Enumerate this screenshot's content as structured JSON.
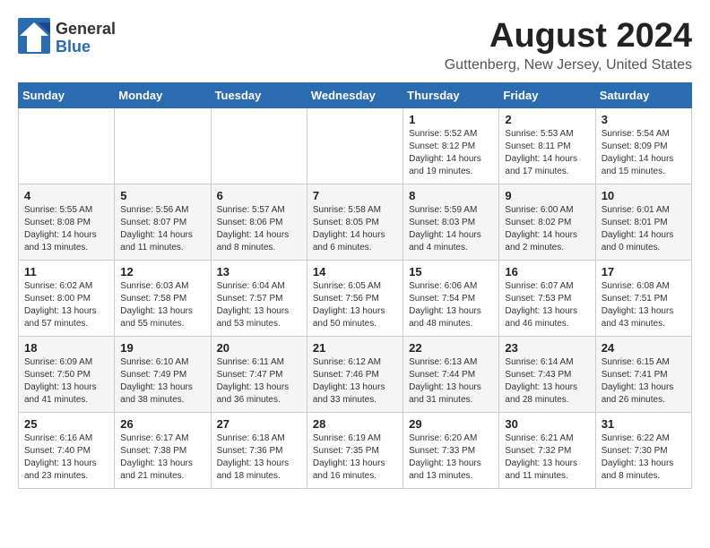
{
  "logo": {
    "general": "General",
    "blue": "Blue"
  },
  "title": {
    "month_year": "August 2024",
    "location": "Guttenberg, New Jersey, United States"
  },
  "headers": [
    "Sunday",
    "Monday",
    "Tuesday",
    "Wednesday",
    "Thursday",
    "Friday",
    "Saturday"
  ],
  "weeks": [
    [
      {
        "day": "",
        "info": ""
      },
      {
        "day": "",
        "info": ""
      },
      {
        "day": "",
        "info": ""
      },
      {
        "day": "",
        "info": ""
      },
      {
        "day": "1",
        "info": "Sunrise: 5:52 AM\nSunset: 8:12 PM\nDaylight: 14 hours\nand 19 minutes."
      },
      {
        "day": "2",
        "info": "Sunrise: 5:53 AM\nSunset: 8:11 PM\nDaylight: 14 hours\nand 17 minutes."
      },
      {
        "day": "3",
        "info": "Sunrise: 5:54 AM\nSunset: 8:09 PM\nDaylight: 14 hours\nand 15 minutes."
      }
    ],
    [
      {
        "day": "4",
        "info": "Sunrise: 5:55 AM\nSunset: 8:08 PM\nDaylight: 14 hours\nand 13 minutes."
      },
      {
        "day": "5",
        "info": "Sunrise: 5:56 AM\nSunset: 8:07 PM\nDaylight: 14 hours\nand 11 minutes."
      },
      {
        "day": "6",
        "info": "Sunrise: 5:57 AM\nSunset: 8:06 PM\nDaylight: 14 hours\nand 8 minutes."
      },
      {
        "day": "7",
        "info": "Sunrise: 5:58 AM\nSunset: 8:05 PM\nDaylight: 14 hours\nand 6 minutes."
      },
      {
        "day": "8",
        "info": "Sunrise: 5:59 AM\nSunset: 8:03 PM\nDaylight: 14 hours\nand 4 minutes."
      },
      {
        "day": "9",
        "info": "Sunrise: 6:00 AM\nSunset: 8:02 PM\nDaylight: 14 hours\nand 2 minutes."
      },
      {
        "day": "10",
        "info": "Sunrise: 6:01 AM\nSunset: 8:01 PM\nDaylight: 14 hours\nand 0 minutes."
      }
    ],
    [
      {
        "day": "11",
        "info": "Sunrise: 6:02 AM\nSunset: 8:00 PM\nDaylight: 13 hours\nand 57 minutes."
      },
      {
        "day": "12",
        "info": "Sunrise: 6:03 AM\nSunset: 7:58 PM\nDaylight: 13 hours\nand 55 minutes."
      },
      {
        "day": "13",
        "info": "Sunrise: 6:04 AM\nSunset: 7:57 PM\nDaylight: 13 hours\nand 53 minutes."
      },
      {
        "day": "14",
        "info": "Sunrise: 6:05 AM\nSunset: 7:56 PM\nDaylight: 13 hours\nand 50 minutes."
      },
      {
        "day": "15",
        "info": "Sunrise: 6:06 AM\nSunset: 7:54 PM\nDaylight: 13 hours\nand 48 minutes."
      },
      {
        "day": "16",
        "info": "Sunrise: 6:07 AM\nSunset: 7:53 PM\nDaylight: 13 hours\nand 46 minutes."
      },
      {
        "day": "17",
        "info": "Sunrise: 6:08 AM\nSunset: 7:51 PM\nDaylight: 13 hours\nand 43 minutes."
      }
    ],
    [
      {
        "day": "18",
        "info": "Sunrise: 6:09 AM\nSunset: 7:50 PM\nDaylight: 13 hours\nand 41 minutes."
      },
      {
        "day": "19",
        "info": "Sunrise: 6:10 AM\nSunset: 7:49 PM\nDaylight: 13 hours\nand 38 minutes."
      },
      {
        "day": "20",
        "info": "Sunrise: 6:11 AM\nSunset: 7:47 PM\nDaylight: 13 hours\nand 36 minutes."
      },
      {
        "day": "21",
        "info": "Sunrise: 6:12 AM\nSunset: 7:46 PM\nDaylight: 13 hours\nand 33 minutes."
      },
      {
        "day": "22",
        "info": "Sunrise: 6:13 AM\nSunset: 7:44 PM\nDaylight: 13 hours\nand 31 minutes."
      },
      {
        "day": "23",
        "info": "Sunrise: 6:14 AM\nSunset: 7:43 PM\nDaylight: 13 hours\nand 28 minutes."
      },
      {
        "day": "24",
        "info": "Sunrise: 6:15 AM\nSunset: 7:41 PM\nDaylight: 13 hours\nand 26 minutes."
      }
    ],
    [
      {
        "day": "25",
        "info": "Sunrise: 6:16 AM\nSunset: 7:40 PM\nDaylight: 13 hours\nand 23 minutes."
      },
      {
        "day": "26",
        "info": "Sunrise: 6:17 AM\nSunset: 7:38 PM\nDaylight: 13 hours\nand 21 minutes."
      },
      {
        "day": "27",
        "info": "Sunrise: 6:18 AM\nSunset: 7:36 PM\nDaylight: 13 hours\nand 18 minutes."
      },
      {
        "day": "28",
        "info": "Sunrise: 6:19 AM\nSunset: 7:35 PM\nDaylight: 13 hours\nand 16 minutes."
      },
      {
        "day": "29",
        "info": "Sunrise: 6:20 AM\nSunset: 7:33 PM\nDaylight: 13 hours\nand 13 minutes."
      },
      {
        "day": "30",
        "info": "Sunrise: 6:21 AM\nSunset: 7:32 PM\nDaylight: 13 hours\nand 11 minutes."
      },
      {
        "day": "31",
        "info": "Sunrise: 6:22 AM\nSunset: 7:30 PM\nDaylight: 13 hours\nand 8 minutes."
      }
    ]
  ]
}
